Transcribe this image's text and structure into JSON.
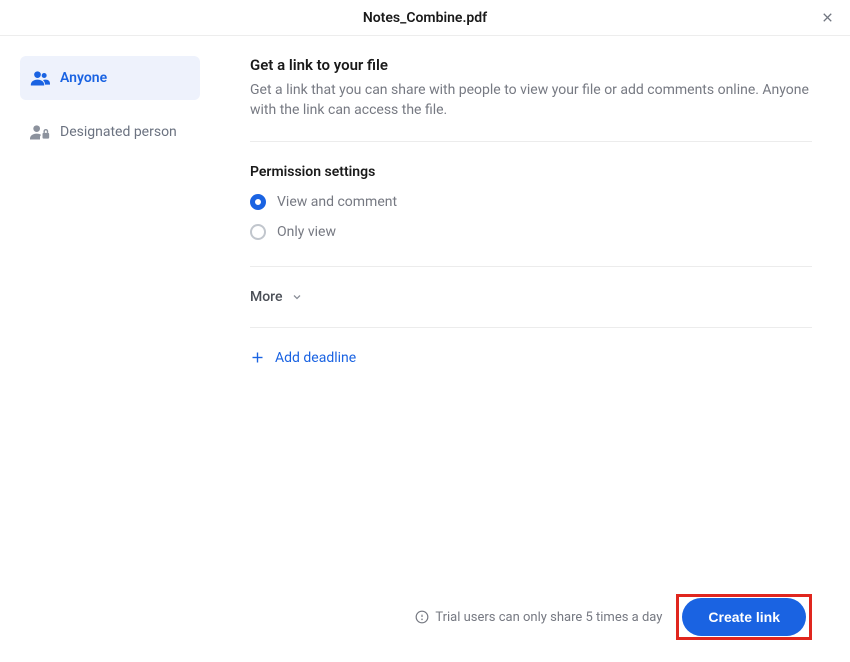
{
  "header": {
    "title": "Notes_Combine.pdf"
  },
  "sidebar": {
    "items": [
      {
        "label": "Anyone"
      },
      {
        "label": "Designated person"
      }
    ]
  },
  "main": {
    "link_section": {
      "title": "Get a link to your file",
      "description": "Get a link that you can share with people to view your file or add comments online. Anyone with the link can access the file."
    },
    "permission": {
      "title": "Permission settings",
      "options": [
        {
          "label": "View and comment",
          "selected": true
        },
        {
          "label": "Only view",
          "selected": false
        }
      ]
    },
    "more_label": "More",
    "add_deadline_label": "Add deadline"
  },
  "footer": {
    "trial_notice": "Trial users can only share 5 times a day",
    "create_button": "Create link"
  }
}
